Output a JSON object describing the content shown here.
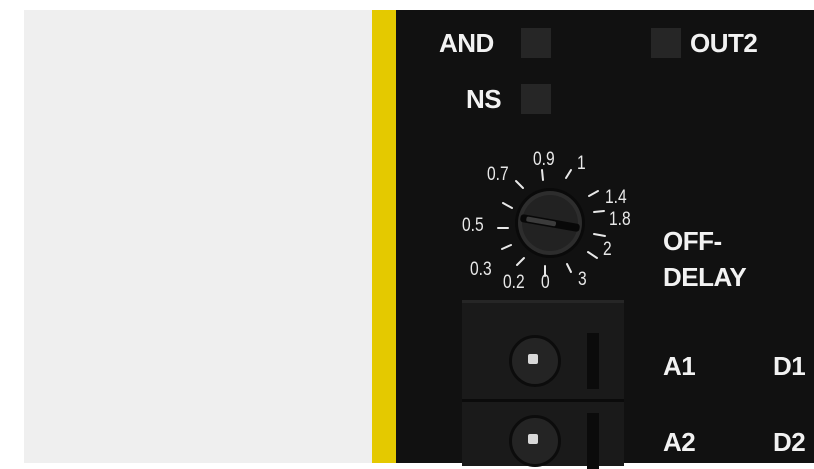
{
  "indicators": {
    "and_label": "AND",
    "ns_label": "NS",
    "out2_label": "OUT2"
  },
  "dial": {
    "scale_labels": [
      "0.7",
      "0.9",
      "1",
      "1.4",
      "0.5",
      "1.8",
      "2",
      "0.3",
      "0.2",
      "0",
      "3"
    ],
    "function_label_line1": "OFF-",
    "function_label_line2": "DELAY"
  },
  "terminals": {
    "a1": "A1",
    "a2": "A2",
    "d1": "D1",
    "d2": "D2"
  },
  "colors": {
    "device_face": "#111111",
    "safety_strip": "#e4c900",
    "led_off": "#262626",
    "label_text": "#f2f2f2"
  }
}
